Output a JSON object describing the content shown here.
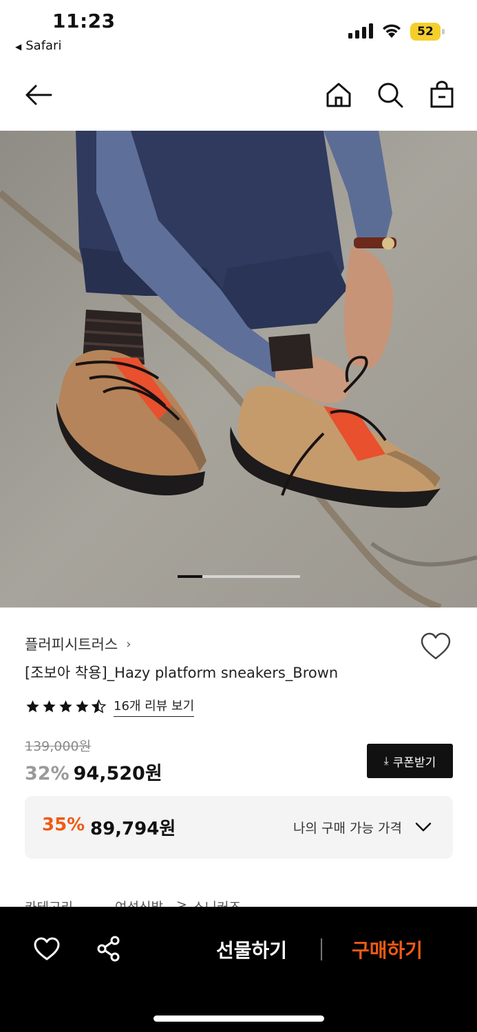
{
  "status_bar": {
    "time": "11:23",
    "back_app": "Safari",
    "battery": "52",
    "battery_color": "#f4cf2c"
  },
  "nav": {
    "icons": [
      "back-arrow-icon",
      "home-icon",
      "search-icon",
      "shopping-bag-icon"
    ]
  },
  "hero": {
    "image_description": "photo of person lacing brown platform sneakers",
    "carousel_position": 1
  },
  "product": {
    "brand": "플러피시트러스",
    "brand_chevron": "›",
    "title": "[조보아 착용]_Hazy platform sneakers_Brown",
    "rating": 4.5,
    "review_link": "16개 리뷰 보기",
    "original_price": "139,000원",
    "discount_rate": "32%",
    "sale_price": "94,520원",
    "coupon_button": "쿠폰받기",
    "coupon_icon": "⤓"
  },
  "best_price": {
    "rate": "35%",
    "price": "89,794원",
    "label": "나의 구매 가능 가격"
  },
  "category": {
    "label": "카테고리",
    "path_1": "여성신발",
    "separator": ">",
    "path_2": "스니커즈"
  },
  "bottom_bar": {
    "gift_label": "선물하기",
    "buy_label": "구매하기",
    "accent_color": "#f05a14"
  }
}
